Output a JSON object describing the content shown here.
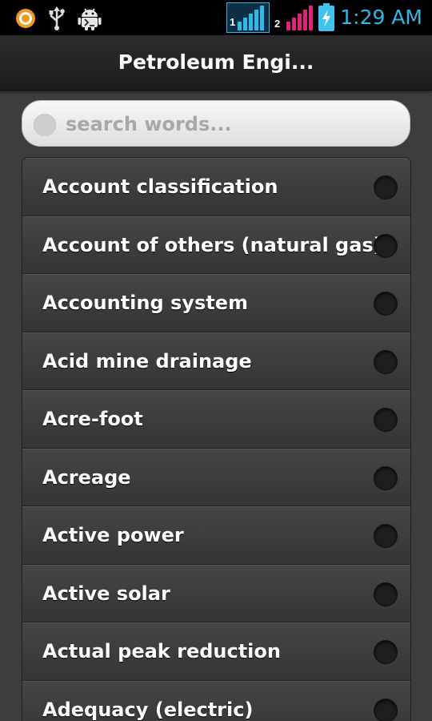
{
  "status_bar": {
    "time": "1:29 AM",
    "sim1_label": "1",
    "sim2_label": "2",
    "icons": [
      "notification-ring-icon",
      "usb-icon",
      "android-debug-icon",
      "signal-sim1-icon",
      "signal-sim2-icon",
      "battery-charging-icon"
    ],
    "colors": {
      "time": "#2fb8e8",
      "sim1_signal": "#2fb8e8",
      "sim2_signal": "#e0227a",
      "battery": "#3fc3ee",
      "notification": "#f39a1e"
    }
  },
  "title_bar": {
    "title": "Petroleum Engi..."
  },
  "search": {
    "placeholder": "search words...",
    "value": ""
  },
  "list": {
    "items": [
      {
        "label": "Account classification"
      },
      {
        "label": "Account of others (natural gas)"
      },
      {
        "label": "Accounting system"
      },
      {
        "label": "Acid mine drainage"
      },
      {
        "label": "Acre-foot"
      },
      {
        "label": "Acreage"
      },
      {
        "label": "Active power"
      },
      {
        "label": "Active solar"
      },
      {
        "label": "Actual peak reduction"
      },
      {
        "label": "Adequacy (electric)"
      }
    ]
  }
}
